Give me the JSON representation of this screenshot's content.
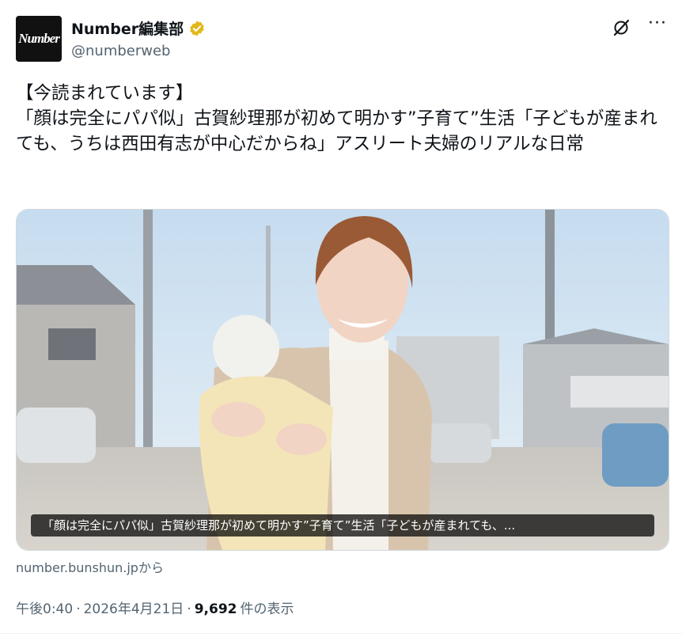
{
  "author": {
    "avatar_text": "Number",
    "display_name": "Number編集部",
    "handle": "@numberweb",
    "verified_color": "#e2b719"
  },
  "icons": {
    "grok": "grok-icon",
    "more": "more-icon"
  },
  "tweet": {
    "text": "【今読まれています】\n「顔は完全にパパ似」古賀紗理那が初めて明かす”子育て”生活「子どもが産まれても、うちは西田有志が中心だからね」アスリート夫婦のリアルな日常"
  },
  "card": {
    "caption": "「顔は完全にパパ似」古賀紗理那が初めて明かす”子育て”生活「子どもが産まれても、...",
    "source": "number.bunshun.jpから"
  },
  "meta": {
    "time": "午後0:40",
    "sep1": "·",
    "date": "2026年4月21日",
    "sep2": "·",
    "views_count": "9,692",
    "views_label": "件の表示"
  }
}
